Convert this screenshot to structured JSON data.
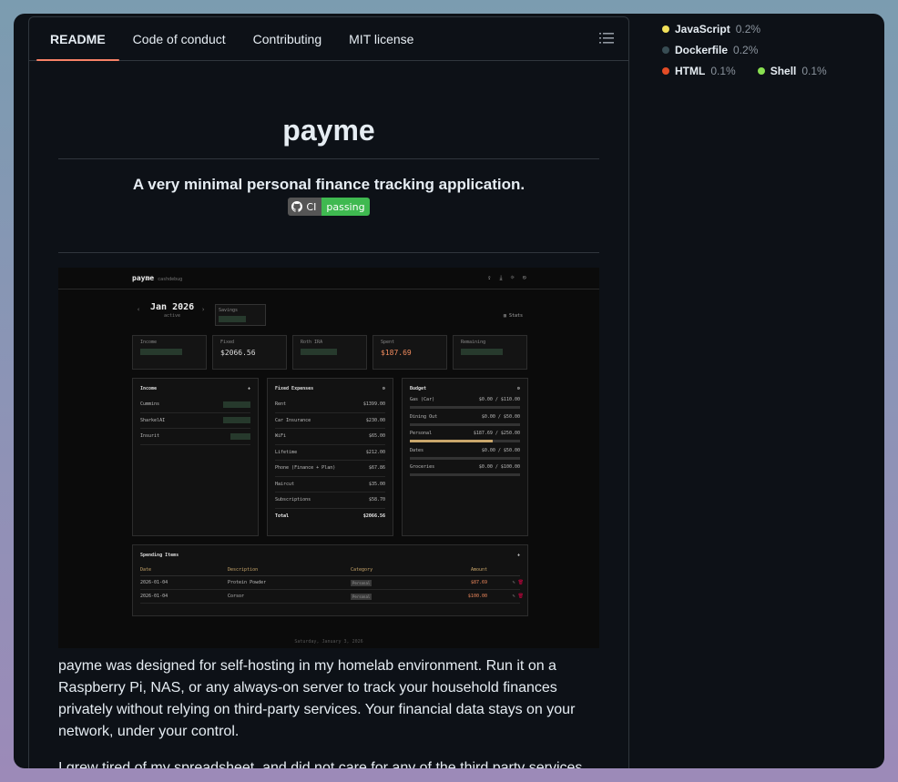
{
  "tabs": [
    "README",
    "Code of conduct",
    "Contributing",
    "MIT license"
  ],
  "readme": {
    "title": "payme",
    "subtitle": "A very minimal personal finance tracking application.",
    "badge_left": "CI",
    "badge_right": "passing",
    "para1": "payme was designed for self-hosting in my homelab environment. Run it on a Raspberry Pi, NAS, or any always-on server to track your household finances privately without relying on third-party services. Your financial data stays on your network, under your control.",
    "para2": "I grew tired of my spreadsheet, and did not care for any of the third party services"
  },
  "languages": [
    {
      "name": "JavaScript",
      "pct": "0.2%",
      "color": "#f1e05a"
    },
    {
      "name": "Dockerfile",
      "pct": "0.2%",
      "color": "#384d54"
    },
    {
      "name": "HTML",
      "pct": "0.1%",
      "color": "#e34c26"
    },
    {
      "name": "Shell",
      "pct": "0.1%",
      "color": "#89e051"
    }
  ],
  "app": {
    "brand": "payme",
    "brand_sub": "cashdebug",
    "month": "Jan 2026",
    "month_status": "active",
    "savings_label": "Savings",
    "stats_label": "Stats",
    "cards": [
      {
        "label": "Income",
        "value": ""
      },
      {
        "label": "Fixed",
        "value": "$2066.56"
      },
      {
        "label": "Roth IRA",
        "value": ""
      },
      {
        "label": "Spent",
        "value": "$187.69"
      },
      {
        "label": "Remaining",
        "value": ""
      }
    ],
    "income": {
      "title": "Income",
      "items": [
        "Cummins",
        "SharkelAI",
        "Insurit"
      ]
    },
    "fixed": {
      "title": "Fixed Expenses",
      "items": [
        {
          "name": "Rent",
          "amount": "$1399.00"
        },
        {
          "name": "Car Insurance",
          "amount": "$230.00"
        },
        {
          "name": "WiFi",
          "amount": "$65.00"
        },
        {
          "name": "Lifetime",
          "amount": "$212.00"
        },
        {
          "name": "Phone (Finance + Plan)",
          "amount": "$67.86"
        },
        {
          "name": "Haircut",
          "amount": "$35.00"
        },
        {
          "name": "Subscriptions",
          "amount": "$58.70"
        }
      ],
      "total_label": "Total",
      "total": "$2066.56"
    },
    "budget": {
      "title": "Budget",
      "items": [
        {
          "name": "Gas (Car)",
          "amount": "$0.00 / $110.00",
          "fill": 0
        },
        {
          "name": "Dining Out",
          "amount": "$0.00 / $50.00",
          "fill": 0
        },
        {
          "name": "Personal",
          "amount": "$187.69 / $250.00",
          "fill": 0.75
        },
        {
          "name": "Dates",
          "amount": "$0.00 / $50.00",
          "fill": 0
        },
        {
          "name": "Groceries",
          "amount": "$0.00 / $100.00",
          "fill": 0
        }
      ]
    },
    "spending": {
      "title": "Spending Items",
      "headers": [
        "Date",
        "Description",
        "Category",
        "Amount"
      ],
      "rows": [
        {
          "date": "2026-01-04",
          "desc": "Protein Powder",
          "cat": "Personal",
          "amount": "$87.69"
        },
        {
          "date": "2026-01-04",
          "desc": "Corsor",
          "cat": "Personal",
          "amount": "$100.00"
        }
      ]
    },
    "footer": "Saturday, January 3, 2026"
  }
}
